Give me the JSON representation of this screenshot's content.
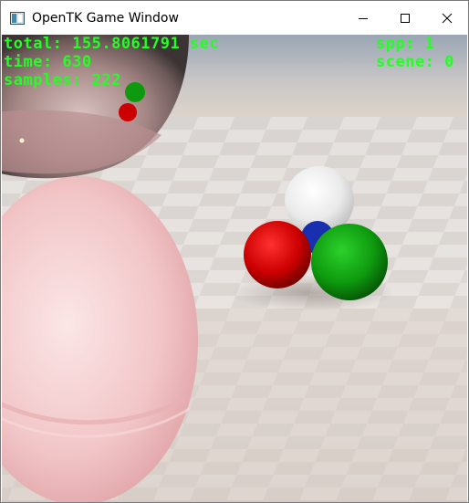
{
  "window": {
    "title": "OpenTK Game Window",
    "icon": "app-window-icon",
    "controls": {
      "minimize_icon": "minimize-icon",
      "maximize_icon": "maximize-icon",
      "close_icon": "close-icon"
    }
  },
  "hud": {
    "total": "total: 155.8061791 sec",
    "time": "time: 630",
    "samples": "samples: 222",
    "spp": "spp: 1",
    "scene": "scene: 0",
    "text_color": "#22ff22"
  },
  "scene_colors": {
    "sky": "#c9c3bf",
    "floor_light": "#eeeae6",
    "floor_dark": "#d8d2cd",
    "mirror_sphere": "#b89a98",
    "glass_sphere": "#f3c7c8",
    "white_ball": "#f2f2f2",
    "red_ball": "#d20000",
    "green_ball": "#0ea10e",
    "blue_ball": "#1a2fb0"
  }
}
